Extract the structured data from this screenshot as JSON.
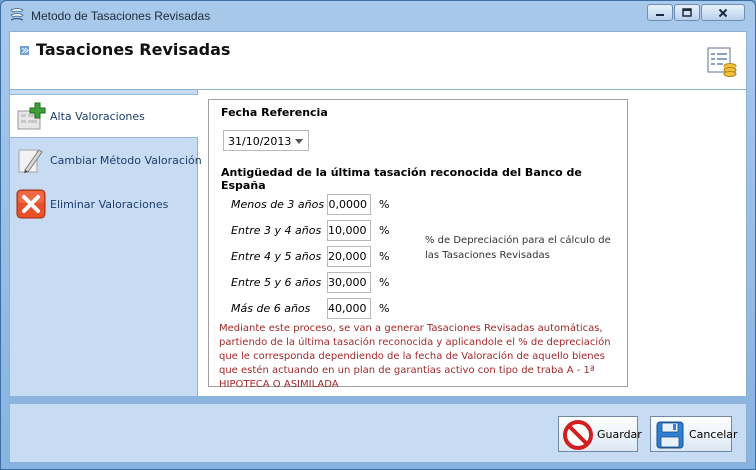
{
  "window": {
    "title": "Metodo de Tasaciones Revisadas",
    "controls": {
      "minimize": "minimize-icon",
      "maximize": "maximize-icon",
      "close": "close-icon"
    }
  },
  "header": {
    "title": "Tasaciones Revisadas",
    "icon": "database-report-icon"
  },
  "sidebar": {
    "items": [
      {
        "label": "Alta Valoraciones",
        "icon": "add-valuation-icon",
        "active": true
      },
      {
        "label": "Cambiar Método Valoración",
        "icon": "edit-pencil-icon",
        "active": false
      },
      {
        "label": "Eliminar Valoraciones",
        "icon": "delete-x-icon",
        "active": false
      }
    ]
  },
  "form": {
    "fecha_label": "Fecha Referencia",
    "fecha_value": "31/10/2013",
    "antiguedad_title": "Antigüedad de la última tasación reconocida del Banco de España",
    "percent_symbol": "%",
    "rows": [
      {
        "label": "Menos de 3 años",
        "value": "0,0000"
      },
      {
        "label": "Entre 3 y 4 años",
        "value": "10,0000"
      },
      {
        "label": "Entre 4 y 5 años",
        "value": "20,0000"
      },
      {
        "label": "Entre 5 y 6 años",
        "value": "30,0000"
      },
      {
        "label": "Más de 6 años",
        "value": "40,0000"
      }
    ],
    "depreciation_note": "% de Depreciación para el cálculo de las Tasaciones Revisadas",
    "warning_text": "Mediante este proceso, se van a generar Tasaciones Revisadas automáticas, partiendo de la última tasación reconocida y aplicandole el % de depreciación que le corresponda dependiendo de la fecha de Valoración de aquello bienes que estén actuando en un plan de garantías activo con tipo de traba A - 1ª HIPOTECA O ASIMILADA"
  },
  "footer": {
    "save_label": "Guardar",
    "save_icon": "no-sign-icon",
    "cancel_label": "Cancelar",
    "cancel_icon": "floppy-disk-icon"
  },
  "colors": {
    "frame": "#86b3e0",
    "sidebar": "#c7dcf3",
    "warning": "#a32a2a",
    "nav_text": "#1b3d6e"
  }
}
